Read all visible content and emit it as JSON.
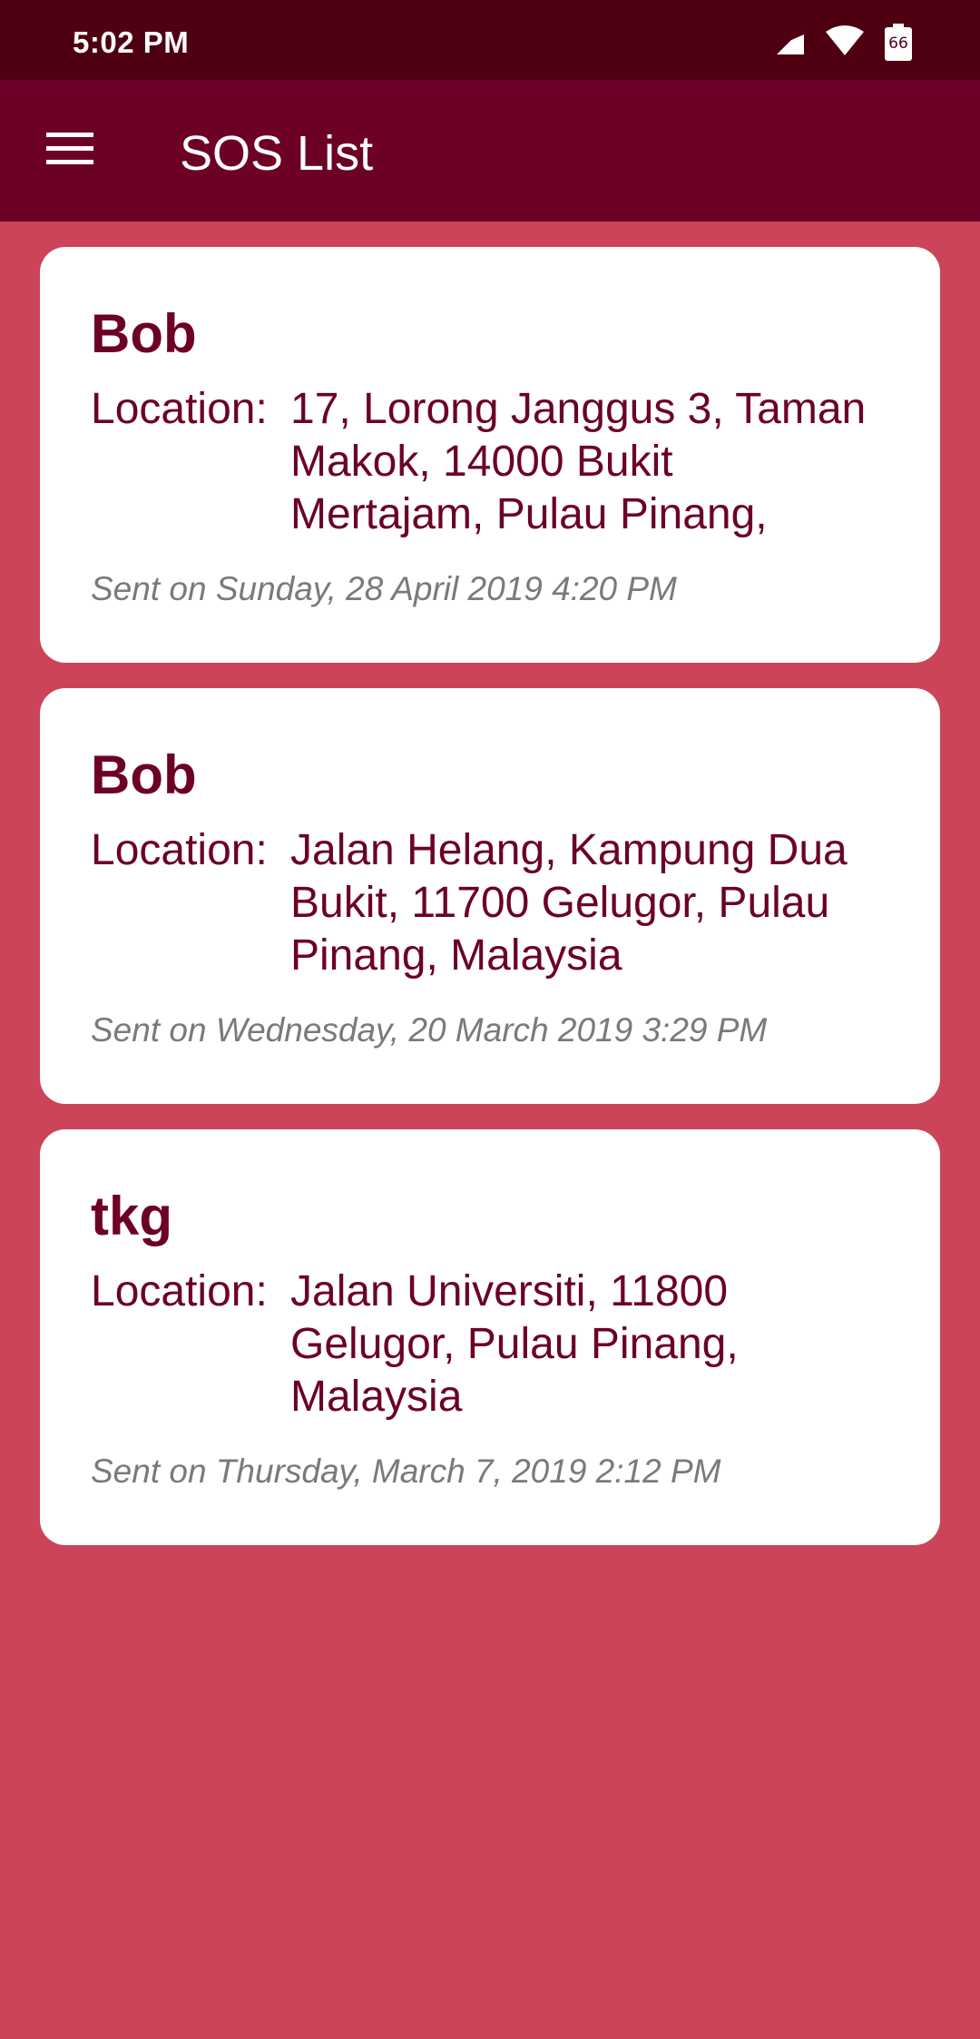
{
  "status_bar": {
    "time": "5:02 PM",
    "battery_level": "66",
    "icons": [
      "signal-icon",
      "wifi-icon",
      "battery-icon"
    ]
  },
  "app_bar": {
    "title": "SOS List",
    "menu_icon": "menu-icon"
  },
  "colors": {
    "status_bar": "#4e0010",
    "app_bar": "#6c0027",
    "background": "#cc4459",
    "card": "#ffffff",
    "accent_text": "#6c0027",
    "meta_text": "#7a7a7a"
  },
  "sos_items": [
    {
      "name": "Bob",
      "location_label": "Location:",
      "location": "17, Lorong Janggus 3, Taman Makok, 14000 Bukit Mertajam, Pulau Pinang,",
      "sent": "Sent on Sunday, 28 April 2019 4:20 PM"
    },
    {
      "name": "Bob",
      "location_label": "Location:",
      "location": "Jalan Helang, Kampung Dua Bukit, 11700 Gelugor, Pulau Pinang, Malaysia",
      "sent": "Sent on Wednesday, 20 March 2019 3:29 PM"
    },
    {
      "name": "tkg",
      "location_label": "Location:",
      "location": "Jalan Universiti, 11800 Gelugor, Pulau Pinang, Malaysia",
      "sent": "Sent on Thursday, March 7, 2019 2:12 PM"
    }
  ]
}
